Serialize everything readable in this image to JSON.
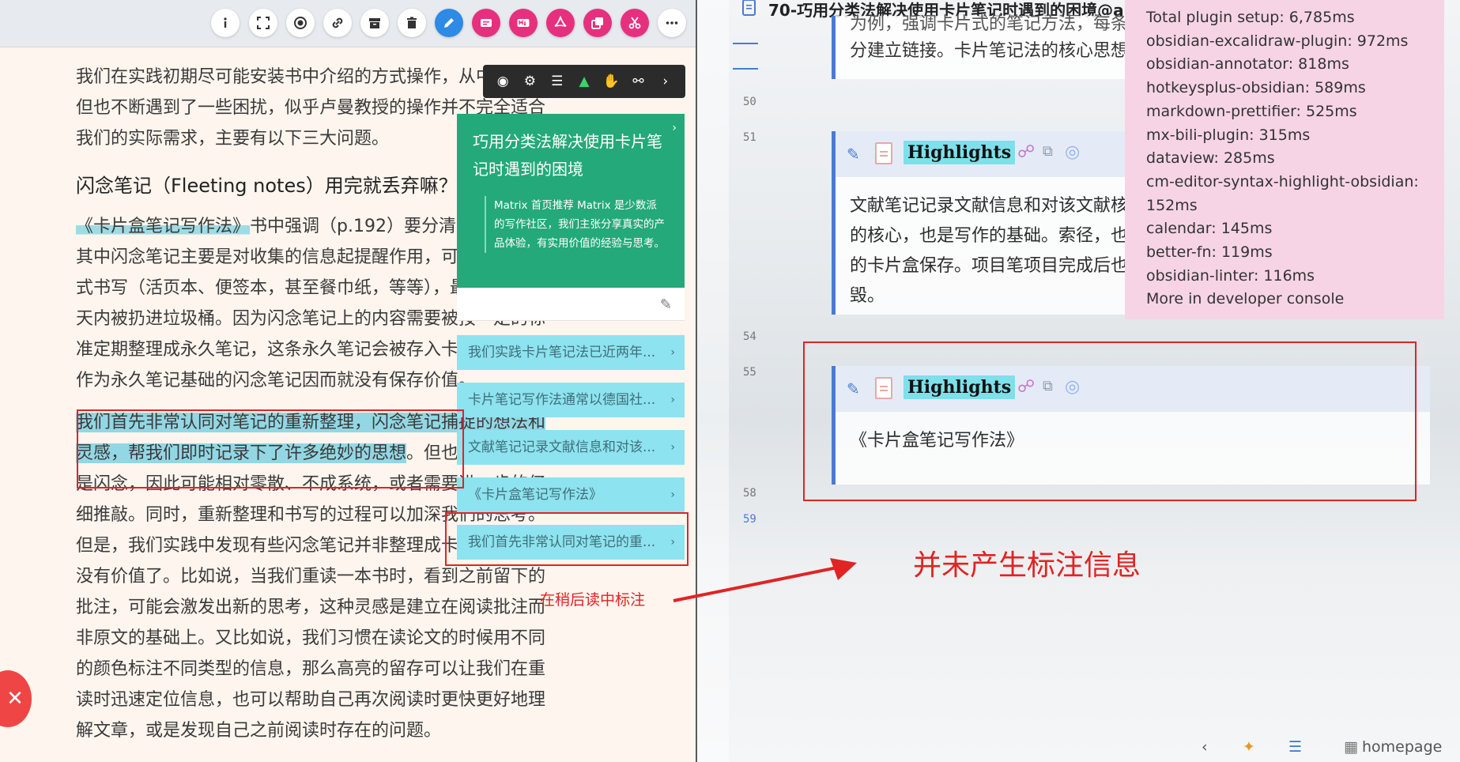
{
  "reader": {
    "toolbar_icons": [
      "info-icon",
      "fullscreen-icon",
      "record-icon",
      "link-icon",
      "archive-icon",
      "trash-icon",
      "pen-icon",
      "comment-icon",
      "markdown-icon",
      "pdf-icon",
      "copy-icon",
      "scissors-icon",
      "more-icon"
    ],
    "paragraphs": [
      "我们在实践初期尽可能安装书中介绍的方式操作，从中受益，但也不断遇到了一些困扰，似乎卢曼教授的操作并不完全适合我们的实际需求，主要有以下三大问题。",
      "闪念笔记（Fleeting notes）用完就丢弃嘛？",
      "《卡片盒笔记写作法》",
      "书中强调（p.192）要分清几类笔记，其中闪念笔记主要是对收集的信息起提醒作用，可以用任何方式书写（活页本、便签本，甚至餐巾纸，等等），最后会在一两天内被扔进垃圾桶。因为闪念笔记上的内容需要被按一定的标准定期整理成永久笔记，这条永久笔记会被存入卡片盒中，而作为永久笔记基础的闪念笔记因而就没有保存价值。",
      "我们首先非常认同对笔记的重新整理，闪念笔记捕捉的想法和灵感，帮我们即时记录下了许多绝妙的思想",
      "。但也正因为它们是闪念，因此可能相对零散、不成系统，或者需要进一步的仔细推敲。同时，重新整理和书写的过程可以加深我们的思考。但是，我们实践中发现有些闪念笔记并非整理成卡片笔记后就没有价值了。比如说，当我们重读一本书时，看到之前留下的批注，可能会激发出新的思考，这种灵感是建立在阅读批注而非原文的基础上。又比如说，我们习惯在读论文的时候用不同的颜色标注不同类型的信息，那么高亮的留存可以让我们在重读时迅速定位信息，也可以帮助自己再次阅读时更快更好地理解文章，或是发现自己之前阅读时存在的问题。"
    ],
    "red_note": "在稍后读中标注",
    "float_toolbar_icons": [
      "eye-icon",
      "gear-icon",
      "list-icon",
      "bulb-icon",
      "hand-icon",
      "lock-icon",
      "chevron-right-icon"
    ],
    "card": {
      "title": "巧用分类法解决使用卡片笔记时遇到的困境",
      "quote": "Matrix 首页推荐 Matrix 是少数派的写作社区，我们主张分享真实的产品体验，有实用价值的经验与思考。"
    },
    "annotations": [
      "我们实践卡片笔记法已近两年...",
      "卡片笔记写作法通常以德国社...",
      "文献笔记记录文献信息和对该...",
      "《卡片盒笔记写作法》",
      "我们首先非常认同对笔记的重..."
    ]
  },
  "editor": {
    "title": "70-巧用分类法解决使用卡片笔记时遇到的困境@a",
    "top_callout_text": "分建立链接。卡片笔记法的核心思想",
    "top_callout_cut": "为例，强调卡片式的笔记方法，每条",
    "line_numbers": {
      "l50": "50",
      "l51": "51",
      "l54": "54",
      "l55": "55",
      "l58": "58",
      "l59": "59"
    },
    "callout1": {
      "title": "Highlights",
      "body": "文献笔记记录文献信息和对该文献核片笔记的核心，也是写作的基础。索径，也有单独的卡片盒保存。项目笔项目完成后也可以销毁。"
    },
    "callout2": {
      "title": "Highlights",
      "body": "《卡片盒笔记写作法》"
    },
    "big_red_text": "并未产生标注信息",
    "bottom_bar": {
      "homepage": "homepage"
    }
  },
  "plugins": {
    "lines": [
      "Total plugin setup: 6,785ms",
      "obsidian-excalidraw-plugin: 972ms",
      "obsidian-annotator: 818ms",
      "hotkeysplus-obsidian: 589ms",
      "markdown-prettifier: 525ms",
      "mx-bili-plugin: 315ms",
      "dataview: 285ms",
      "cm-editor-syntax-highlight-obsidian: 152ms",
      "calendar: 145ms",
      "better-fn: 119ms",
      "obsidian-linter: 116ms",
      "More in developer console"
    ]
  },
  "colors": {
    "accent_green": "#24a97a",
    "annotation_cyan": "#8de3ef",
    "annotation_red": "#e02424",
    "obsidian_accent": "#4a7bd0",
    "plugin_panel_bg": "#f6d4e6"
  }
}
